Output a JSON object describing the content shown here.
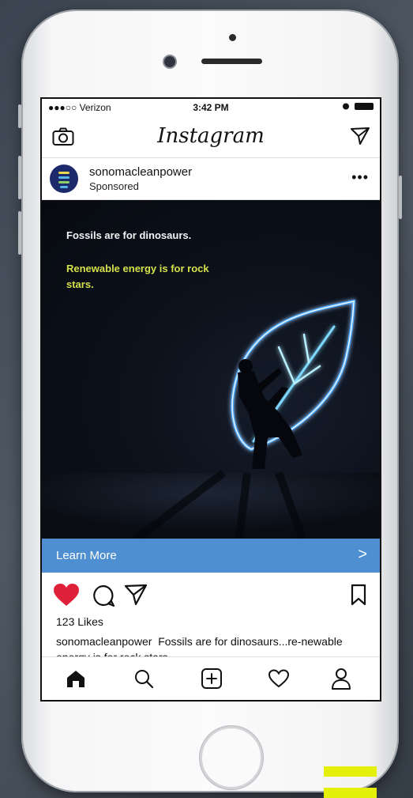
{
  "status_bar": {
    "carrier": "●●●○○ Verizon",
    "time": "3:42 PM"
  },
  "app": {
    "title": "Instagram"
  },
  "post": {
    "username": "sonomacleanpower",
    "sponsored_label": "Sponsored",
    "more_label": "•••",
    "ad_headline": "Fossils are for dinosaurs.",
    "ad_tagline": "Renewable energy is for rock stars.",
    "cta_label": "Learn More",
    "cta_chevron": ">",
    "likes": "123 Likes",
    "caption_user": "sonomacleanpower",
    "caption_text": "Fossils are for dinosaurs...re-newable energy is for rock stars."
  },
  "colors": {
    "cta": "#4d8fd0",
    "like": "#e0213a",
    "tagline": "#d5e04a",
    "accent_bar": "#e4f00a"
  },
  "icons": [
    "camera-icon",
    "send-icon",
    "heart-icon",
    "comment-icon",
    "share-icon",
    "bookmark-icon",
    "home-icon",
    "search-icon",
    "add-icon",
    "activity-icon",
    "profile-icon"
  ]
}
